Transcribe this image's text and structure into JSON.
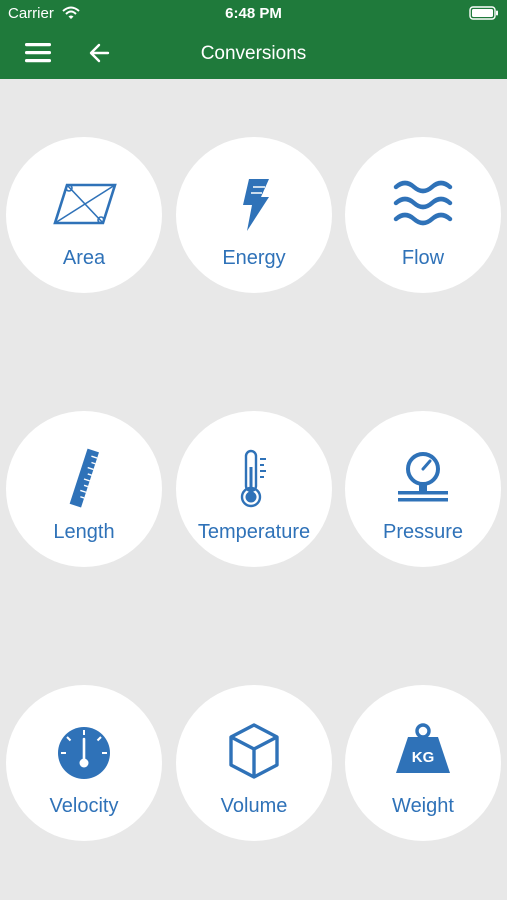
{
  "status": {
    "carrier": "Carrier",
    "time": "6:48 PM"
  },
  "nav": {
    "title": "Conversions"
  },
  "colors": {
    "bar": "#1f7a3b",
    "accent": "#2f72b8",
    "background": "#e8e8e8"
  },
  "tiles": [
    {
      "label": "Area",
      "icon": "parallelogram-icon"
    },
    {
      "label": "Energy",
      "icon": "lightning-icon"
    },
    {
      "label": "Flow",
      "icon": "waves-icon"
    },
    {
      "label": "Length",
      "icon": "ruler-icon"
    },
    {
      "label": "Temperature",
      "icon": "thermometer-icon"
    },
    {
      "label": "Pressure",
      "icon": "pressure-gauge-icon"
    },
    {
      "label": "Velocity",
      "icon": "speedometer-icon"
    },
    {
      "label": "Volume",
      "icon": "cube-icon"
    },
    {
      "label": "Weight",
      "icon": "kg-weight-icon",
      "icon_text": "KG"
    }
  ]
}
